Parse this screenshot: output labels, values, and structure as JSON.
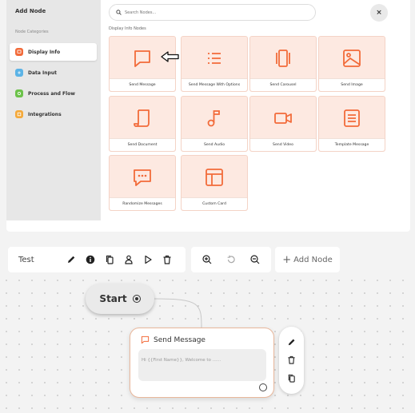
{
  "panel": {
    "title": "Add Node",
    "categories_label": "Node Categories",
    "categories": [
      {
        "label": "Display Info",
        "color": "#f26b3a",
        "active": true
      },
      {
        "label": "Data Input",
        "color": "#5bb3e6",
        "active": false
      },
      {
        "label": "Process and Flow",
        "color": "#6cc24a",
        "active": false
      },
      {
        "label": "Integrations",
        "color": "#f4a93b",
        "active": false
      }
    ],
    "search_placeholder": "Search Nodes...",
    "section_title": "Display Info Nodes",
    "close_label": "×",
    "nodes": [
      {
        "label": "Send Message",
        "icon": "message-icon"
      },
      {
        "label": "Send Message With Options",
        "icon": "list-icon"
      },
      {
        "label": "Send Carousel",
        "icon": "carousel-icon"
      },
      {
        "label": "Send Image",
        "icon": "image-icon"
      },
      {
        "label": "Send Document",
        "icon": "document-icon"
      },
      {
        "label": "Send Audio",
        "icon": "audio-icon"
      },
      {
        "label": "Send Video",
        "icon": "video-icon"
      },
      {
        "label": "Template Message",
        "icon": "template-icon"
      },
      {
        "label": "Randomize Messages",
        "icon": "randomize-icon"
      },
      {
        "label": "Custom Card",
        "icon": "custom-card-icon"
      }
    ]
  },
  "toolbar": {
    "flow_name": "Test",
    "add_node_label": "Add Node"
  },
  "canvas": {
    "start_label": "Start",
    "message_node": {
      "title": "Send Message",
      "preview": "Hi {{First Name}}, Welcome to ......"
    }
  },
  "colors": {
    "accent": "#f26b3a",
    "card_bg": "#fde9e1"
  }
}
